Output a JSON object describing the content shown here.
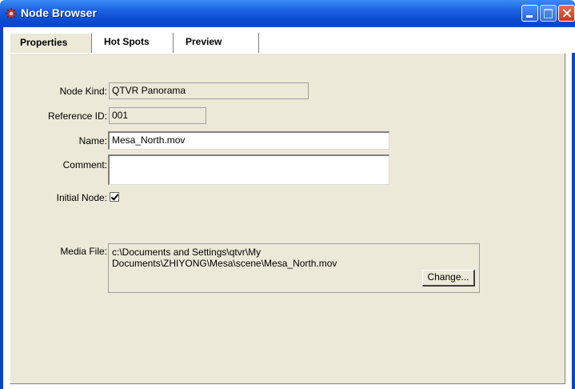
{
  "window": {
    "title": "Node Browser"
  },
  "tabs": [
    {
      "label": "Properties",
      "active": true
    },
    {
      "label": "Hot Spots",
      "active": false
    },
    {
      "label": "Preview",
      "active": false
    }
  ],
  "form": {
    "node_kind": {
      "label": "Node Kind:",
      "value": "QTVR Panorama"
    },
    "reference_id": {
      "label": "Reference ID:",
      "value": "001"
    },
    "name": {
      "label": "Name:",
      "value": "Mesa_North.mov"
    },
    "comment": {
      "label": "Comment:",
      "value": ""
    },
    "initial_node": {
      "label": "Initial Node:",
      "checked": true
    },
    "media_file": {
      "label": "Media File:",
      "path_line1": "c:\\Documents and Settings\\qtvr\\My",
      "path_line2": "Documents\\ZHIYONG\\Mesa\\scene\\Mesa_North.mov",
      "change_label": "Change..."
    }
  },
  "colors": {
    "titlebar": "#0a46c4",
    "panel": "#ece9d8"
  }
}
